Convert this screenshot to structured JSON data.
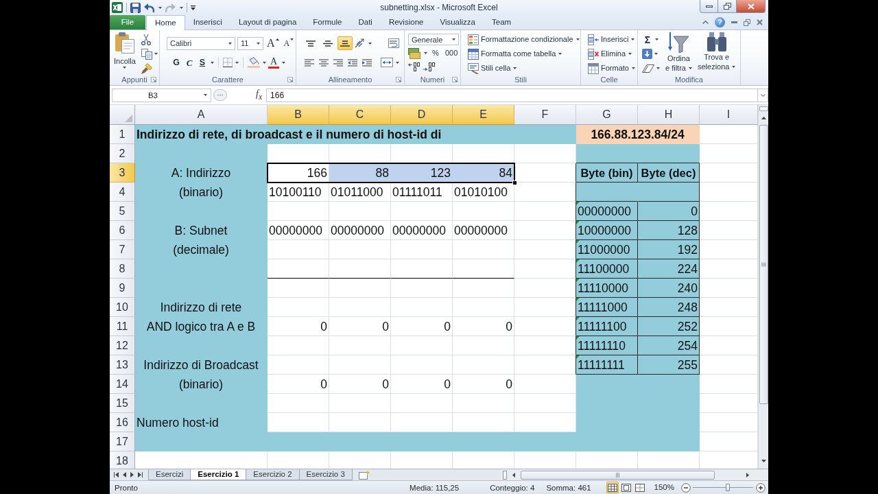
{
  "window": {
    "title": "subnetting.xlsx - Microsoft Excel"
  },
  "ribbon_tabs": [
    {
      "label": "File",
      "kind": "file",
      "selected": false
    },
    {
      "label": "Home",
      "kind": "tab",
      "selected": true
    },
    {
      "label": "Inserisci",
      "kind": "tab",
      "selected": false
    },
    {
      "label": "Layout di pagina",
      "kind": "tab",
      "selected": false
    },
    {
      "label": "Formule",
      "kind": "tab",
      "selected": false
    },
    {
      "label": "Dati",
      "kind": "tab",
      "selected": false
    },
    {
      "label": "Revisione",
      "kind": "tab",
      "selected": false
    },
    {
      "label": "Visualizza",
      "kind": "tab",
      "selected": false
    },
    {
      "label": "Team",
      "kind": "tab",
      "selected": false
    }
  ],
  "help_button": "?",
  "ribbon": {
    "clipboard": {
      "title": "Appunti",
      "paste": "Incolla"
    },
    "font": {
      "title": "Carattere",
      "font_name": "Calibri",
      "font_size": "11",
      "grow": "A",
      "shrink": "A",
      "bold": "G",
      "italic": "C",
      "underline": "S",
      "font_color": "A"
    },
    "alignment": {
      "title": "Allineamento",
      "vertical": [
        {
          "kind": "top",
          "selected": false
        },
        {
          "kind": "middle",
          "selected": false
        },
        {
          "kind": "bottom",
          "selected": true
        }
      ]
    },
    "number": {
      "title": "Numeri",
      "format": "Generale",
      "percent": "%",
      "thousands": "000"
    },
    "styles": {
      "title": "Stili",
      "buttons": [
        "Formattazione condizionale",
        "Formatta come tabella",
        "Stili cella"
      ]
    },
    "cells": {
      "title": "Celle",
      "buttons": [
        "Inserisci",
        "Elimina",
        "Formato"
      ]
    },
    "editing": {
      "title": "Modifica",
      "autosum": "Σ",
      "sort": [
        "Ordina",
        "e filtra"
      ],
      "find": [
        "Trova e",
        "seleziona"
      ]
    }
  },
  "formula_bar": {
    "name_box": "B3",
    "function_label": "f$_{x}$",
    "value": "166"
  },
  "sheet": {
    "columns": [
      {
        "label": "A",
        "selected": false
      },
      {
        "label": "B",
        "selected": true
      },
      {
        "label": "C",
        "selected": true
      },
      {
        "label": "D",
        "selected": true
      },
      {
        "label": "E",
        "selected": true
      },
      {
        "label": "F",
        "selected": false
      },
      {
        "label": "G",
        "selected": false
      },
      {
        "label": "H",
        "selected": false
      },
      {
        "label": "I",
        "selected": false
      }
    ],
    "rows": [
      {
        "label": "1",
        "selected": false,
        "cells": [
          {
            "text": "Indirizzo di rete, di broadcast e il numero di host-id di",
            "kind": "title"
          },
          null,
          null,
          null,
          null,
          null,
          {
            "text": "166.88.123.84/24",
            "kind": "banner"
          },
          null,
          null
        ]
      },
      {
        "label": "2",
        "selected": false
      },
      {
        "label": "3",
        "selected": true,
        "cells": [
          {
            "text": "A: Indirizzo",
            "kind": "label"
          },
          {
            "text": "166",
            "kind": "number"
          },
          {
            "text": "88",
            "kind": "number"
          },
          {
            "text": "123",
            "kind": "number"
          },
          {
            "text": "84",
            "kind": "number"
          },
          null,
          {
            "text": "Byte (bin)",
            "kind": "header"
          },
          {
            "text": "Byte (dec)",
            "kind": "header"
          },
          null
        ]
      },
      {
        "label": "4",
        "selected": false,
        "cells": [
          {
            "text": "(binario)",
            "kind": "label"
          },
          {
            "text": "10100110",
            "kind": "text"
          },
          {
            "text": "01011000",
            "kind": "text"
          },
          {
            "text": "01111011",
            "kind": "text"
          },
          {
            "text": "01010100",
            "kind": "text"
          },
          null,
          null,
          null,
          null
        ]
      },
      {
        "label": "5",
        "selected": false,
        "cells": [
          null,
          null,
          null,
          null,
          null,
          null,
          {
            "text": "00000000",
            "kind": "flagged"
          },
          {
            "text": "0",
            "kind": "number"
          },
          null
        ]
      },
      {
        "label": "6",
        "selected": false,
        "cells": [
          {
            "text": "B: Subnet",
            "kind": "label"
          },
          {
            "text": "00000000",
            "kind": "text"
          },
          {
            "text": "00000000",
            "kind": "text"
          },
          {
            "text": "00000000",
            "kind": "text"
          },
          {
            "text": "00000000",
            "kind": "text"
          },
          null,
          {
            "text": "10000000",
            "kind": "flagged"
          },
          {
            "text": "128",
            "kind": "number"
          },
          null
        ]
      },
      {
        "label": "7",
        "selected": false,
        "cells": [
          {
            "text": "(decimale)",
            "kind": "label"
          },
          null,
          null,
          null,
          null,
          null,
          {
            "text": "11000000",
            "kind": "flagged"
          },
          {
            "text": "192",
            "kind": "number"
          },
          null
        ]
      },
      {
        "label": "8",
        "selected": false,
        "cells": [
          null,
          null,
          null,
          null,
          null,
          null,
          {
            "text": "11100000",
            "kind": "flagged"
          },
          {
            "text": "224",
            "kind": "number"
          },
          null
        ]
      },
      {
        "label": "9",
        "selected": false,
        "cells": [
          null,
          null,
          null,
          null,
          null,
          null,
          {
            "text": "11110000",
            "kind": "flagged"
          },
          {
            "text": "240",
            "kind": "number"
          },
          null
        ]
      },
      {
        "label": "10",
        "selected": false,
        "cells": [
          {
            "text": "Indirizzo di rete",
            "kind": "label"
          },
          null,
          null,
          null,
          null,
          null,
          {
            "text": "11111000",
            "kind": "flagged"
          },
          {
            "text": "248",
            "kind": "number"
          },
          null
        ]
      },
      {
        "label": "11",
        "selected": false,
        "cells": [
          {
            "text": "AND logico tra A e B",
            "kind": "label"
          },
          {
            "text": "0",
            "kind": "number"
          },
          {
            "text": "0",
            "kind": "number"
          },
          {
            "text": "0",
            "kind": "number"
          },
          {
            "text": "0",
            "kind": "number"
          },
          null,
          {
            "text": "11111100",
            "kind": "flagged"
          },
          {
            "text": "252",
            "kind": "number"
          },
          null
        ]
      },
      {
        "label": "12",
        "selected": false,
        "cells": [
          null,
          null,
          null,
          null,
          null,
          null,
          {
            "text": "11111110",
            "kind": "flagged"
          },
          {
            "text": "254",
            "kind": "number"
          },
          null
        ]
      },
      {
        "label": "13",
        "selected": false,
        "cells": [
          {
            "text": "Indirizzo di Broadcast",
            "kind": "label"
          },
          null,
          null,
          null,
          null,
          null,
          {
            "text": "11111111",
            "kind": "flagged"
          },
          {
            "text": "255",
            "kind": "number"
          },
          null
        ]
      },
      {
        "label": "14",
        "selected": false,
        "cells": [
          {
            "text": "(binario)",
            "kind": "label"
          },
          {
            "text": "0",
            "kind": "number"
          },
          {
            "text": "0",
            "kind": "number"
          },
          {
            "text": "0",
            "kind": "number"
          },
          {
            "text": "0",
            "kind": "number"
          },
          null,
          null,
          null,
          null
        ]
      },
      {
        "label": "15",
        "selected": false
      },
      {
        "label": "16",
        "selected": false,
        "cells": [
          {
            "text": "Numero host-id",
            "kind": "note"
          },
          null,
          null,
          null,
          null,
          null,
          null,
          null,
          null
        ]
      },
      {
        "label": "17",
        "selected": false
      },
      {
        "label": "18",
        "selected": false
      }
    ]
  },
  "sheet_tabs": [
    {
      "label": "Esercizi",
      "selected": false
    },
    {
      "label": "Esercizio 1",
      "selected": true
    },
    {
      "label": "Esercizio 2",
      "selected": false
    },
    {
      "label": "Esercizio 3",
      "selected": false
    }
  ],
  "status_bar": {
    "mode": "Pronto",
    "average": "Media: 115,25",
    "count": "Conteggio: 4",
    "sum": "Somma: 461",
    "views": [
      {
        "kind": "normal",
        "selected": true
      },
      {
        "kind": "page_layout",
        "selected": false
      },
      {
        "kind": "page_break",
        "selected": false
      }
    ],
    "zoom": "150%",
    "zoom_slider": {
      "level": 0.58
    }
  }
}
